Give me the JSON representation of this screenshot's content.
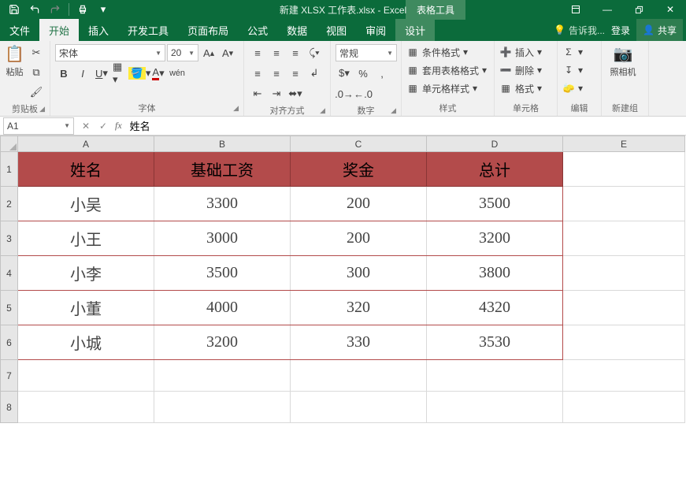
{
  "title": "新建 XLSX 工作表.xlsx - Excel",
  "contextual_tab_group": "表格工具",
  "tabs": {
    "file": "文件",
    "home": "开始",
    "insert": "插入",
    "developer": "开发工具",
    "page_layout": "页面布局",
    "formulas": "公式",
    "data": "数据",
    "view": "视图",
    "review": "审阅",
    "design": "设计"
  },
  "tell_me": "告诉我...",
  "login": "登录",
  "share": "共享",
  "ribbon": {
    "clipboard": {
      "label": "剪贴板",
      "paste": "粘贴"
    },
    "font": {
      "label": "字体",
      "name": "宋体",
      "size": "20"
    },
    "alignment": {
      "label": "对齐方式"
    },
    "number": {
      "label": "数字",
      "format": "常规"
    },
    "styles": {
      "label": "样式",
      "conditional": "条件格式",
      "table": "套用表格格式",
      "cell": "单元格样式"
    },
    "cells": {
      "label": "单元格",
      "insert": "插入",
      "delete": "删除",
      "format": "格式"
    },
    "editing": {
      "label": "编辑"
    },
    "newgroup": {
      "label": "新建组",
      "camera": "照相机"
    }
  },
  "name_box": "A1",
  "formula": "姓名",
  "columns": [
    "A",
    "B",
    "C",
    "D",
    "E"
  ],
  "rows": [
    "1",
    "2",
    "3",
    "4",
    "5",
    "6",
    "7",
    "8"
  ],
  "chart_data": {
    "type": "table",
    "headers": [
      "姓名",
      "基础工资",
      "奖金",
      "总计"
    ],
    "data": [
      [
        "小吴",
        3300,
        200,
        3500
      ],
      [
        "小王",
        3000,
        200,
        3200
      ],
      [
        "小李",
        3500,
        300,
        3800
      ],
      [
        "小董",
        4000,
        320,
        4320
      ],
      [
        "小城",
        3200,
        330,
        3530
      ]
    ]
  }
}
